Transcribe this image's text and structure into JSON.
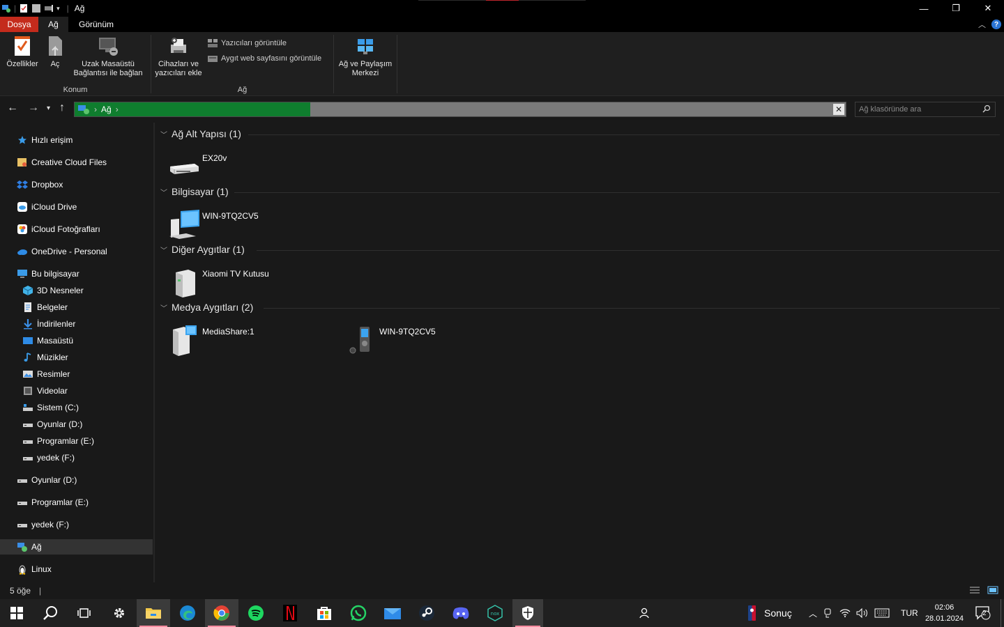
{
  "window": {
    "title": "Ağ",
    "controls": {
      "minimize": "—",
      "maximize": "❐",
      "close": "✕"
    }
  },
  "tabs": {
    "file": "Dosya",
    "network": "Ağ",
    "view": "Görünüm"
  },
  "ribbon": {
    "location_group": {
      "label": "Konum",
      "properties": "Özellikler",
      "open": "Aç",
      "remote_desktop_line1": "Uzak Masaüstü",
      "remote_desktop_line2": "Bağlantısı ile bağlan"
    },
    "network_group": {
      "label": "Ağ",
      "add_devices_line1": "Cihazları ve",
      "add_devices_line2": "yazıcıları ekle",
      "view_printers": "Yazıcıları görüntüle",
      "view_device_webpage": "Aygıt web sayfasını görüntüle"
    },
    "sharing_center_line1": "Ağ ve Paylaşım",
    "sharing_center_line2": "Merkezi"
  },
  "address": {
    "path": "Ağ",
    "separator": "›",
    "search_placeholder": "Ağ klasöründe ara"
  },
  "nav": {
    "quick_access": "Hızlı erişim",
    "creative_cloud": "Creative Cloud Files",
    "dropbox": "Dropbox",
    "icloud_drive": "iCloud Drive",
    "icloud_photos": "iCloud Fotoğrafları",
    "onedrive": "OneDrive - Personal",
    "this_pc": "Bu bilgisayar",
    "objects3d": "3D Nesneler",
    "documents": "Belgeler",
    "downloads": "İndirilenler",
    "desktop": "Masaüstü",
    "music": "Müzikler",
    "pictures": "Resimler",
    "videos": "Videolar",
    "drive_c": "Sistem (C:)",
    "drive_d": "Oyunlar (D:)",
    "drive_e": "Programlar (E:)",
    "drive_f": "yedek (F:)",
    "drive_d2": "Oyunlar (D:)",
    "drive_e2": "Programlar (E:)",
    "drive_f2": "yedek (F:)",
    "network": "Ağ",
    "linux": "Linux"
  },
  "groups": {
    "infrastructure": {
      "header": "Ağ Alt Yapısı (1)",
      "items": [
        "EX20v"
      ]
    },
    "computers": {
      "header": "Bilgisayar (1)",
      "items": [
        "WIN-9TQ2CV5"
      ]
    },
    "other": {
      "header": "Diğer Aygıtlar (1)",
      "items": [
        "Xiaomi TV Kutusu"
      ]
    },
    "media": {
      "header": "Medya Aygıtları (2)",
      "items": [
        "MediaShare:1",
        "WIN-9TQ2CV5"
      ]
    }
  },
  "status": {
    "count": "5 öğe",
    "separator": "|"
  },
  "taskbar": {
    "widget_text": "Sonuç",
    "language": "TUR",
    "time": "02:06",
    "date": "28.01.2024",
    "notification_count": "2"
  },
  "colors": {
    "file_tab": "#c42b1c",
    "address_progress": "#0f7d2e",
    "background": "#191919",
    "ribbon": "#1f1f1f"
  }
}
